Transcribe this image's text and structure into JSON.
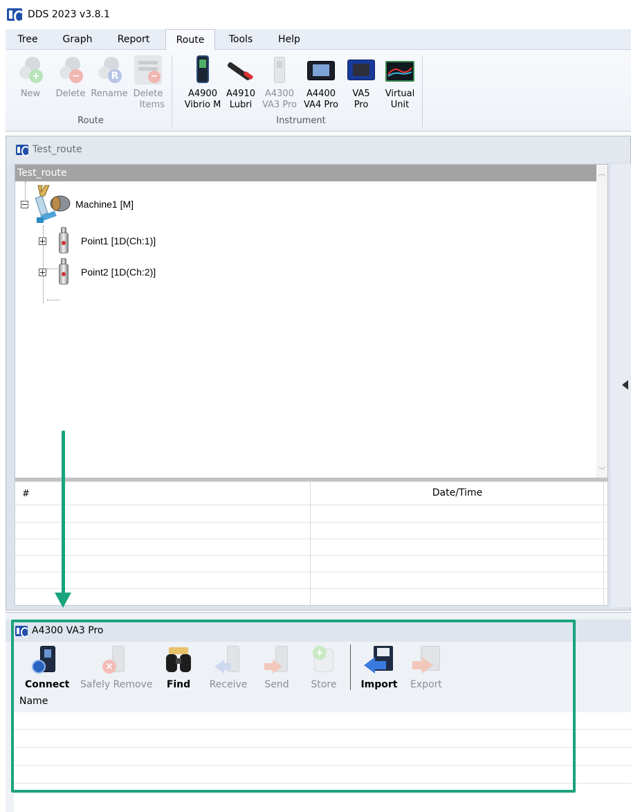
{
  "window": {
    "title": "DDS 2023 v3.8.1"
  },
  "menu": {
    "tabs": [
      "Tree",
      "Graph",
      "Report",
      "Route",
      "Tools",
      "Help"
    ],
    "active": "Route"
  },
  "ribbon": {
    "route_group": {
      "label": "Route",
      "buttons": [
        {
          "label1": "New",
          "label2": ""
        },
        {
          "label1": "Delete",
          "label2": ""
        },
        {
          "label1": "Rename",
          "label2": ""
        },
        {
          "label1": "Delete",
          "label2": "Items"
        }
      ]
    },
    "instrument_group": {
      "label": "Instrument",
      "buttons": [
        {
          "label1": "A4900",
          "label2": "Vibrio M"
        },
        {
          "label1": "A4910",
          "label2": "Lubri"
        },
        {
          "label1": "A4300",
          "label2": "VA3 Pro"
        },
        {
          "label1": "A4400",
          "label2": "VA4 Pro"
        },
        {
          "label1": "VA5",
          "label2": "Pro"
        },
        {
          "label1": "Virtual",
          "label2": "Unit"
        }
      ]
    }
  },
  "route_pane": {
    "title": "Test_route",
    "tree_header": "Test_route",
    "nodes": {
      "machine": "Machine1 [M]",
      "point1": "Point1 [1D(Ch:1)]",
      "point2": "Point2 [1D(Ch:2)]"
    },
    "grid_headers": {
      "number": "#",
      "datetime": "Date/Time"
    }
  },
  "device_pane": {
    "title": "A4300 VA3 Pro",
    "buttons": [
      "Connect",
      "Safely Remove",
      "Find",
      "Receive",
      "Send",
      "Store",
      "Import",
      "Export"
    ],
    "name_header": "Name"
  },
  "colors": {
    "highlight": "#1aa37d",
    "tree_header_bg": "#a3a3a3",
    "app_blue": "#1f4fa8"
  }
}
